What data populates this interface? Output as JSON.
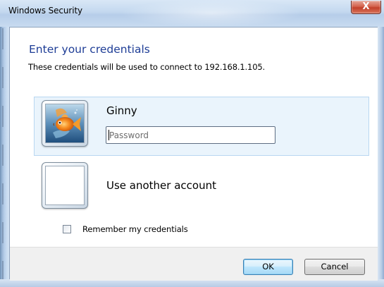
{
  "window": {
    "title": "Windows Security",
    "close_label": "X"
  },
  "dialog": {
    "heading": "Enter your credentials",
    "subtext": "These credentials will be used to connect to 192.168.1.105."
  },
  "accounts": [
    {
      "name": "Ginny",
      "selected": true,
      "avatar": "goldfish-avatar",
      "password_placeholder": "Password",
      "password_value": ""
    },
    {
      "name": "Use another account",
      "selected": false,
      "avatar": "blank-avatar"
    }
  ],
  "remember": {
    "label": "Remember my credentials",
    "checked": false
  },
  "buttons": {
    "ok": "OK",
    "cancel": "Cancel"
  },
  "colors": {
    "heading": "#1e3d96",
    "selected_tile": "#eaf4fc",
    "selected_tile_border": "#b9d7f1",
    "close_button": "#c2402a",
    "footer": "#f0f0f0"
  }
}
